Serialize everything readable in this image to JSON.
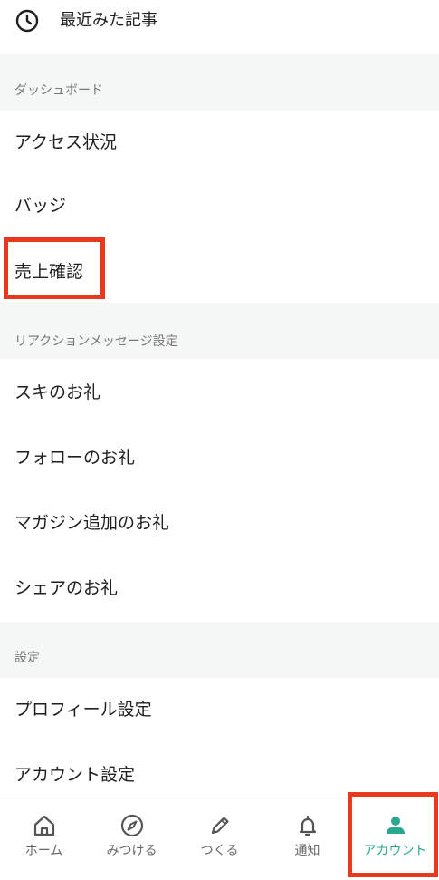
{
  "recent": {
    "icon": "clock-icon",
    "label": "最近みた記事"
  },
  "sections": [
    {
      "header": "ダッシュボード",
      "items": [
        "アクセス状況",
        "バッジ",
        "売上確認"
      ]
    },
    {
      "header": "リアクションメッセージ設定",
      "items": [
        "スキのお礼",
        "フォローのお礼",
        "マガジン追加のお礼",
        "シェアのお礼"
      ]
    },
    {
      "header": "設定",
      "items": [
        "プロフィール設定",
        "アカウント設定"
      ]
    }
  ],
  "highlight_color": "#e8381d",
  "tabbar": {
    "active_color": "#2aa88f",
    "tabs": [
      {
        "label": "ホーム",
        "icon": "home-icon"
      },
      {
        "label": "みつける",
        "icon": "compass-icon"
      },
      {
        "label": "つくる",
        "icon": "pencil-icon"
      },
      {
        "label": "通知",
        "icon": "bell-icon"
      },
      {
        "label": "アカウント",
        "icon": "person-icon",
        "active": true
      }
    ]
  }
}
